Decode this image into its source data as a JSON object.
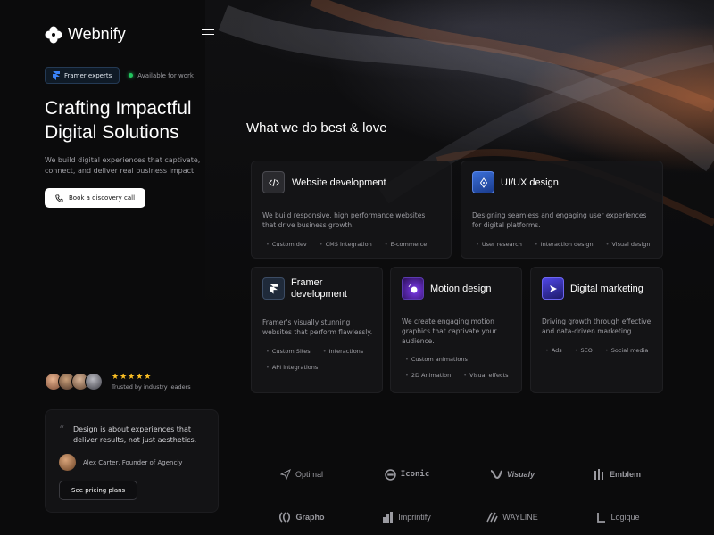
{
  "brand": {
    "name": "Webnify"
  },
  "header": {
    "badge": "Framer experts",
    "availability": "Available for work"
  },
  "hero": {
    "title_line1": "Crafting Impactful",
    "title_line2": "Digital Solutions",
    "subtitle": "We build digital experiences that captivate, connect, and deliver real business impact",
    "cta": "Book a discovery call"
  },
  "trust": {
    "stars": "★★★★★",
    "text": "Trusted by industry leaders"
  },
  "testimonial": {
    "quote": "Design is about experiences that deliver results, not just aesthetics.",
    "author": "Alex Carter, Founder of Agenciy",
    "button": "See pricing plans"
  },
  "services": {
    "title": "What we do best & love",
    "cards": [
      {
        "title": "Website development",
        "desc": "We build responsive, high performance websites that drive business growth.",
        "tags": [
          "Custom dev",
          "CMS integration",
          "E-commerce"
        ],
        "icon": "code-icon"
      },
      {
        "title": "UI/UX design",
        "desc": "Designing seamless and engaging user experiences for digital platforms.",
        "tags": [
          "User research",
          "Interaction design",
          "Visual design"
        ],
        "icon": "pen-icon"
      },
      {
        "title": "Framer development",
        "desc": "Framer's visually stunning websites that perform flawlessly.",
        "tags": [
          "Custom Sites",
          "Interactions",
          "API integrations"
        ],
        "icon": "framer-icon"
      },
      {
        "title": "Motion design",
        "desc": "We create engaging motion graphics that captivate your audience.",
        "tags": [
          "Custom animations",
          "2D Animation",
          "Visual effects"
        ],
        "icon": "motion-icon"
      },
      {
        "title": "Digital marketing",
        "desc": "Driving growth through effective and data-driven marketing",
        "tags": [
          "Ads",
          "SEO",
          "Social media"
        ],
        "icon": "megaphone-icon"
      }
    ]
  },
  "clients": [
    "Optimal",
    "Iconic",
    "Visualy",
    "Emblem",
    "Grapho",
    "Imprintify",
    "WAYLINE",
    "Logique"
  ],
  "colors": {
    "accent_green": "#22c55e",
    "star": "#fbbf24",
    "background": "#0b0b0c"
  }
}
